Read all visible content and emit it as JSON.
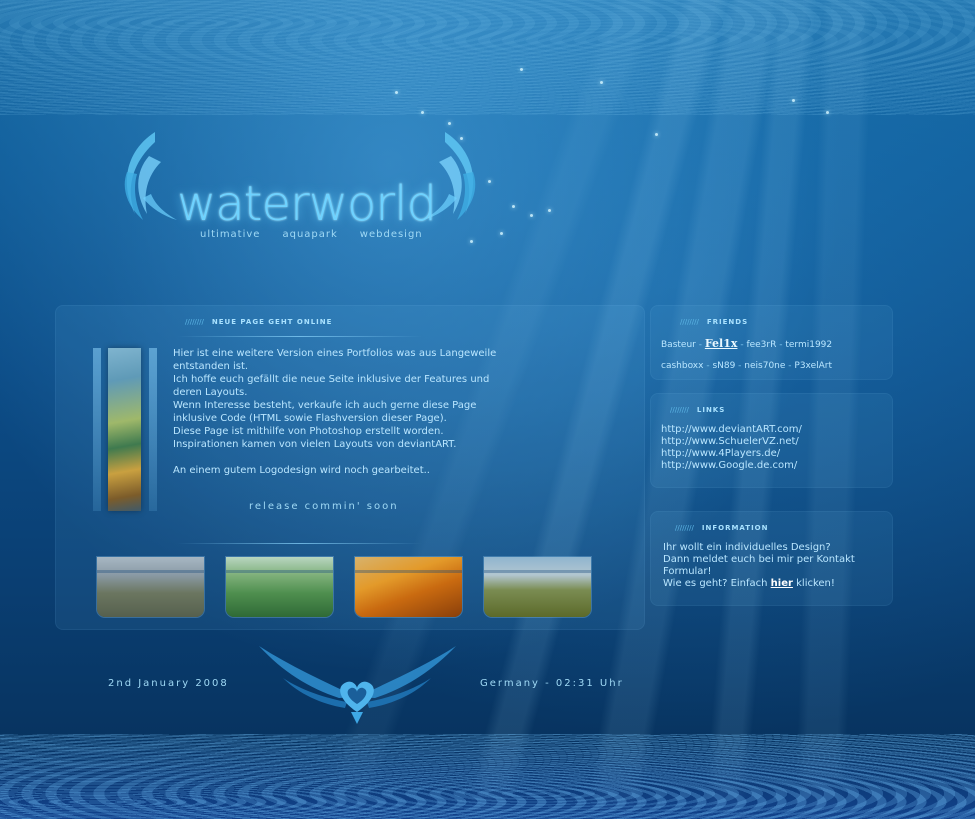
{
  "logo": {
    "title": "waterworld",
    "tagline": [
      "ultimative",
      "aquapark",
      "webdesign"
    ],
    "icons": [
      "wing-left-icon",
      "wing-right-icon"
    ]
  },
  "main": {
    "header": "NEUE PAGE GEHT ONLINE",
    "header_prefix": "////////",
    "paragraphs": [
      "Hier ist eine weitere Version eines Portfolios was aus Langeweile entstanden ist.",
      "Ich hoffe euch gefällt die neue Seite inklusive der Features und deren Layouts.",
      "Wenn Interesse besteht, verkaufe ich auch gerne diese Page inklusive Code (HTML sowie Flashversion dieser Page).",
      "Diese Page ist mithilfe von Photoshop erstellt worden.",
      "Inspirationen kamen von vielen Layouts von deviantART."
    ],
    "note": "An einem gutem Logodesign wird noch gearbeitet..",
    "release": "release commin' soon",
    "thumbnails": [
      "landscape-thumbnail",
      "flower-thumbnail",
      "orange-petal-thumbnail",
      "meadow-thumbnail"
    ]
  },
  "friends": {
    "header": "FRIENDS",
    "header_prefix": "////////",
    "line1": {
      "a": "Basteur",
      "b": "Fel1x",
      "c": "fee3rR",
      "d": "termi1992"
    },
    "line2": [
      "cashboxx",
      "sN89",
      "neis70ne",
      "P3xelArt"
    ],
    "separator": " - "
  },
  "links": {
    "header": "LINKS",
    "header_prefix": "////////",
    "items": [
      "http://www.deviantART.com/",
      "http://www.SchuelerVZ.net/",
      "http://www.4Players.de/",
      "http://www.Google.de.com/"
    ]
  },
  "information": {
    "header": "INFORMATION",
    "header_prefix": "////////",
    "line1": "Ihr wollt ein individuelles Design?",
    "line2": "Dann meldet euch bei mir per Kontakt Formular!",
    "line3_prefix": "Wie es geht? Einfach",
    "line3_link": "hier",
    "line3_suffix": "klicken!"
  },
  "footer": {
    "date": "2nd January 2008",
    "location": "Germany - 02:31 Uhr",
    "emblem_icon": "winged-heart-icon"
  },
  "colors": {
    "accent": "#6ed2ff",
    "text": "#b9e6ff",
    "background_dark": "#062e57"
  }
}
